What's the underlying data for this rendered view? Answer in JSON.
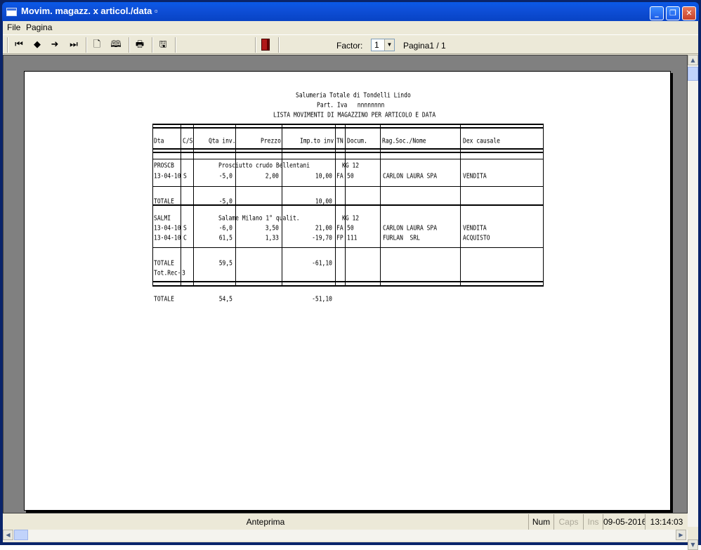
{
  "window": {
    "title": "Movim. magazz. x articol./data ▫"
  },
  "menu": {
    "file": "File",
    "pagina": "Pagina"
  },
  "toolbar": {
    "factor_label": "Factor:",
    "factor_value": "1",
    "page_indicator": "Pagina1 / 1"
  },
  "report": {
    "company": "Salumeria Totale di Tondelli Lindo",
    "vat": "Part. Iva   nnnnnnnn",
    "heading": "LISTA MOVIMENTI DI MAGAZZINO PER ARTICOLO E DATA",
    "columns": [
      "Dta",
      "C/S",
      "Qta inv.",
      "Prezzo",
      "Imp.to inv.",
      "TN",
      "Docum.",
      "Rag.Soc./Nome",
      "Dex causale"
    ],
    "groups": [
      {
        "code": "PROSCB",
        "desc": "Prosciutto crudo Bellentani",
        "um": "KG 12",
        "rows": [
          {
            "date": "13-04-10",
            "cs": "S",
            "qty": "-5,0",
            "price": "2,00",
            "amount": "10,00",
            "tn": "FA",
            "doc": "50",
            "name": "CARLON LAURA SPA",
            "causale": "VENDITA"
          }
        ],
        "total_label": "TOTALE",
        "total_qty": "-5,0",
        "total_amount": "10,00"
      },
      {
        "code": "SALMI",
        "desc": "Salame Milano 1° qualit.",
        "um": "KG 12",
        "rows": [
          {
            "date": "13-04-10",
            "cs": "S",
            "qty": "-6,0",
            "price": "3,50",
            "amount": "21,00",
            "tn": "FA",
            "doc": "50",
            "name": "CARLON LAURA SPA",
            "causale": "VENDITA"
          },
          {
            "date": "13-04-10",
            "cs": "C",
            "qty": "61,5",
            "price": "1,33",
            "amount": "-19,70",
            "tn": "FP",
            "doc": "111",
            "name": "FURLAN  SRL",
            "causale": "ACQUISTO"
          }
        ],
        "total_label": "TOTALE",
        "total_qty": "59,5",
        "total_amount": "-61,10",
        "rec_label": "Tot.Rec-",
        "rec_value": "3"
      }
    ],
    "grand_total_label": "TOTALE",
    "grand_total_qty": "54,5",
    "grand_total_amount": "-51,10"
  },
  "status": {
    "mode": "Anteprima",
    "num": "Num",
    "caps": "Caps",
    "ins": "Ins",
    "date": "09-05-2016",
    "time": "13:14:03"
  },
  "colors": {
    "title_bar": "#0a5ae8",
    "preview_bg": "#808080",
    "exit_icon": "#b01818"
  }
}
